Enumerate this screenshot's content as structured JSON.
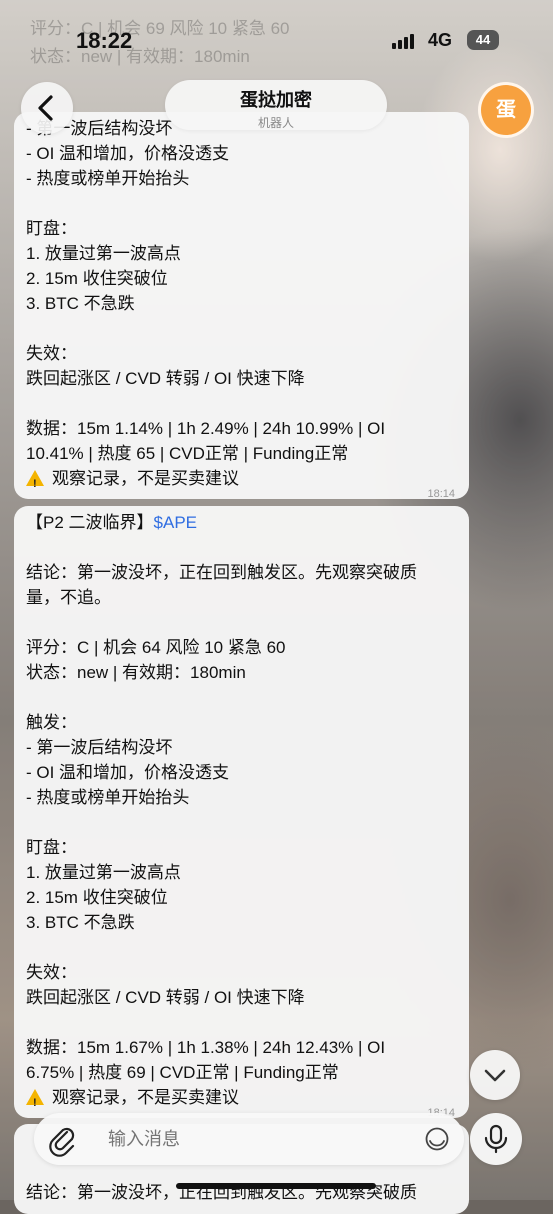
{
  "status_bar": {
    "time": "18:22",
    "network": "4G",
    "battery": "44"
  },
  "ghost_text": [
    "评分：C | 机会 69 风险 10 紧急 60",
    "状态：new | 有效期：180min"
  ],
  "header": {
    "title": "蛋挞加密",
    "subtitle": "机器人",
    "avatar_char": "蛋"
  },
  "messages": [
    {
      "partial_top": "- 第一波后结构没坏",
      "lines": [
        "- OI 温和增加，价格没透支",
        "- 热度或榜单开始抬头",
        "",
        "盯盘：",
        "1. 放量过第一波高点",
        "2. 15m 收住突破位",
        "3. BTC 不急跌",
        "",
        "失效：",
        "跌回起涨区 / CVD 转弱 / OI 快速下降",
        "",
        "数据：15m 1.14% | 1h 2.49% | 24h 10.99% | OI",
        "10.41% | 热度 65 | CVD正常 | Funding正常"
      ],
      "notice": "观察记录，不是买卖建议",
      "time": "18:14"
    },
    {
      "head_label": "【P2 二波临界】",
      "head_ticker": "$APE",
      "lines": [
        "",
        "结论：第一波没坏，正在回到触发区。先观察突破质",
        "量，不追。",
        "",
        "评分：C | 机会 64 风险 10 紧急 60",
        "状态：new | 有效期：180min",
        "",
        "触发：",
        "- 第一波后结构没坏",
        "- OI 温和增加，价格没透支",
        "- 热度或榜单开始抬头",
        "",
        "盯盘：",
        "1. 放量过第一波高点",
        "2. 15m 收住突破位",
        "3. BTC 不急跌",
        "",
        "失效：",
        "跌回起涨区 / CVD 转弱 / OI 快速下降",
        "",
        "数据：15m 1.67% | 1h 1.38% | 24h 12.43% | OI",
        "6.75% | 热度 69 | CVD正常 | Funding正常"
      ],
      "notice": "观察记录，不是买卖建议",
      "time": "18:14"
    },
    {
      "partial_bottom": "结论：第一波没坏，正在回到触发区。先观察突破质"
    }
  ],
  "input": {
    "placeholder": "输入消息"
  },
  "icons": {
    "back": "chevron-left-icon",
    "attach": "paperclip-icon",
    "emoji": "emoji-icon",
    "mic": "microphone-icon",
    "scroll": "chevron-down-icon",
    "warning": "warning-icon"
  },
  "colors": {
    "avatar": "#f7a13f",
    "ticker_link": "#2f6de1",
    "warning": "#f4b400"
  }
}
